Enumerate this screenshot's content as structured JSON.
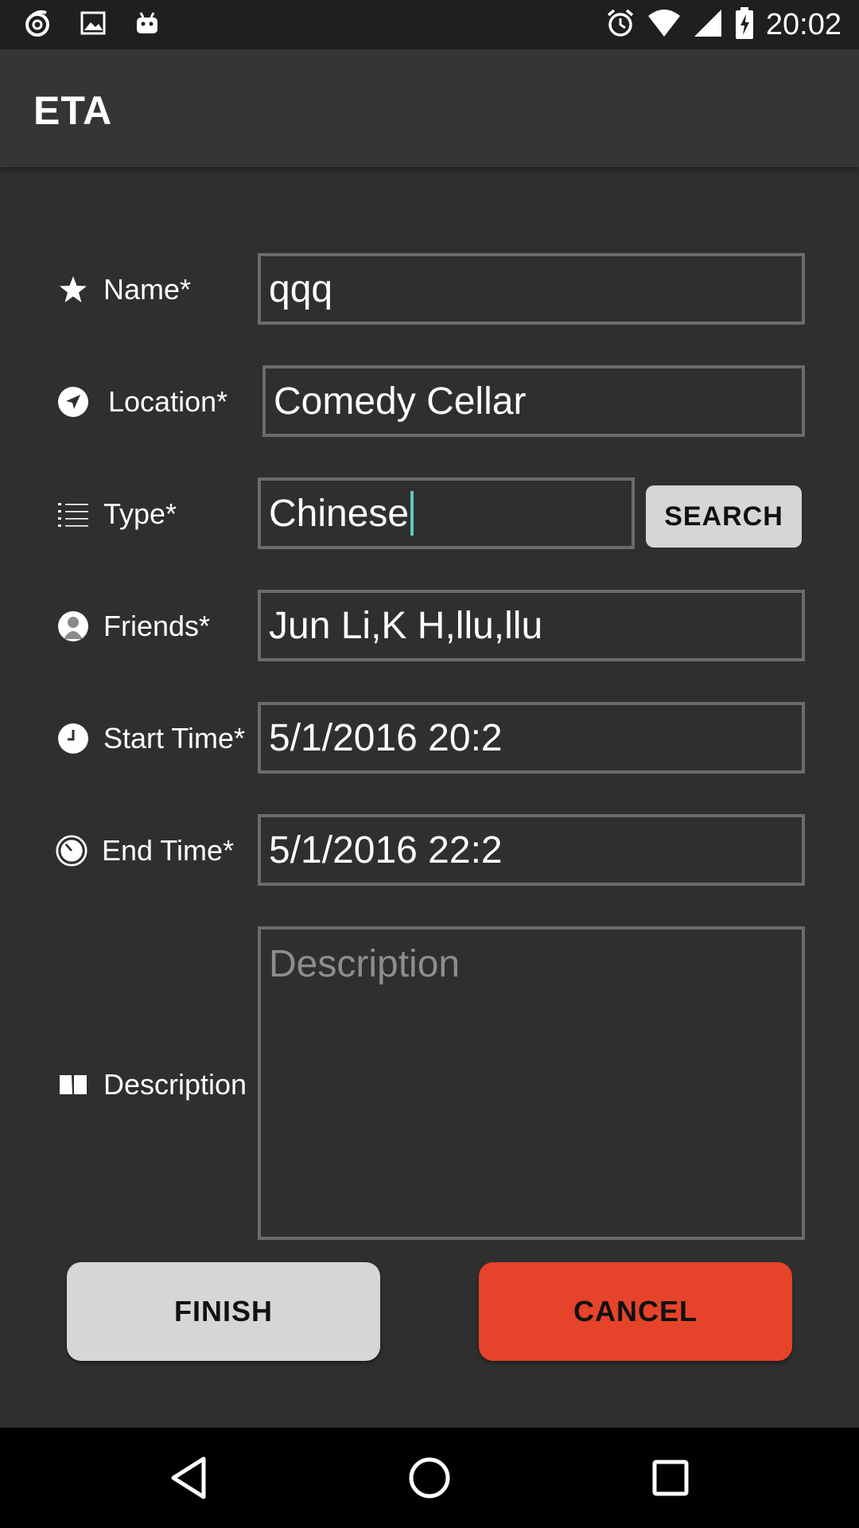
{
  "status_bar": {
    "time": "20:02",
    "left_icons": [
      "sync-icon",
      "image-icon",
      "android-icon"
    ],
    "right_icons": [
      "alarm-icon",
      "wifi-icon",
      "signal-icon",
      "battery-charging-icon"
    ]
  },
  "app_bar": {
    "title": "ETA"
  },
  "form": {
    "name": {
      "label": "Name*",
      "value": "qqq",
      "icon": "star-icon"
    },
    "location": {
      "label": "Location*",
      "value": "Comedy Cellar",
      "icon": "navigation-icon"
    },
    "type": {
      "label": "Type*",
      "value": "Chinese",
      "icon": "list-icon"
    },
    "friends": {
      "label": "Friends*",
      "value": "Jun Li,K H,llu,llu",
      "icon": "person-icon"
    },
    "start_time": {
      "label": "Start Time*",
      "value": "5/1/2016 20:2",
      "icon": "clock-icon"
    },
    "end_time": {
      "label": "End Time*",
      "value": "5/1/2016 22:2",
      "icon": "timer-icon"
    },
    "description": {
      "label": "Description",
      "value": "",
      "placeholder": "Description",
      "icon": "book-icon"
    }
  },
  "buttons": {
    "search": "SEARCH",
    "finish": "FINISH",
    "cancel": "CANCEL"
  },
  "colors": {
    "background": "#2f2f2f",
    "app_bar": "#353535",
    "accent_cancel": "#e5432a",
    "neutral_button": "#d6d6d6",
    "caret": "#5fc8c4"
  },
  "nav_bar": {
    "icons": [
      "back-icon",
      "home-icon",
      "recents-icon"
    ]
  }
}
